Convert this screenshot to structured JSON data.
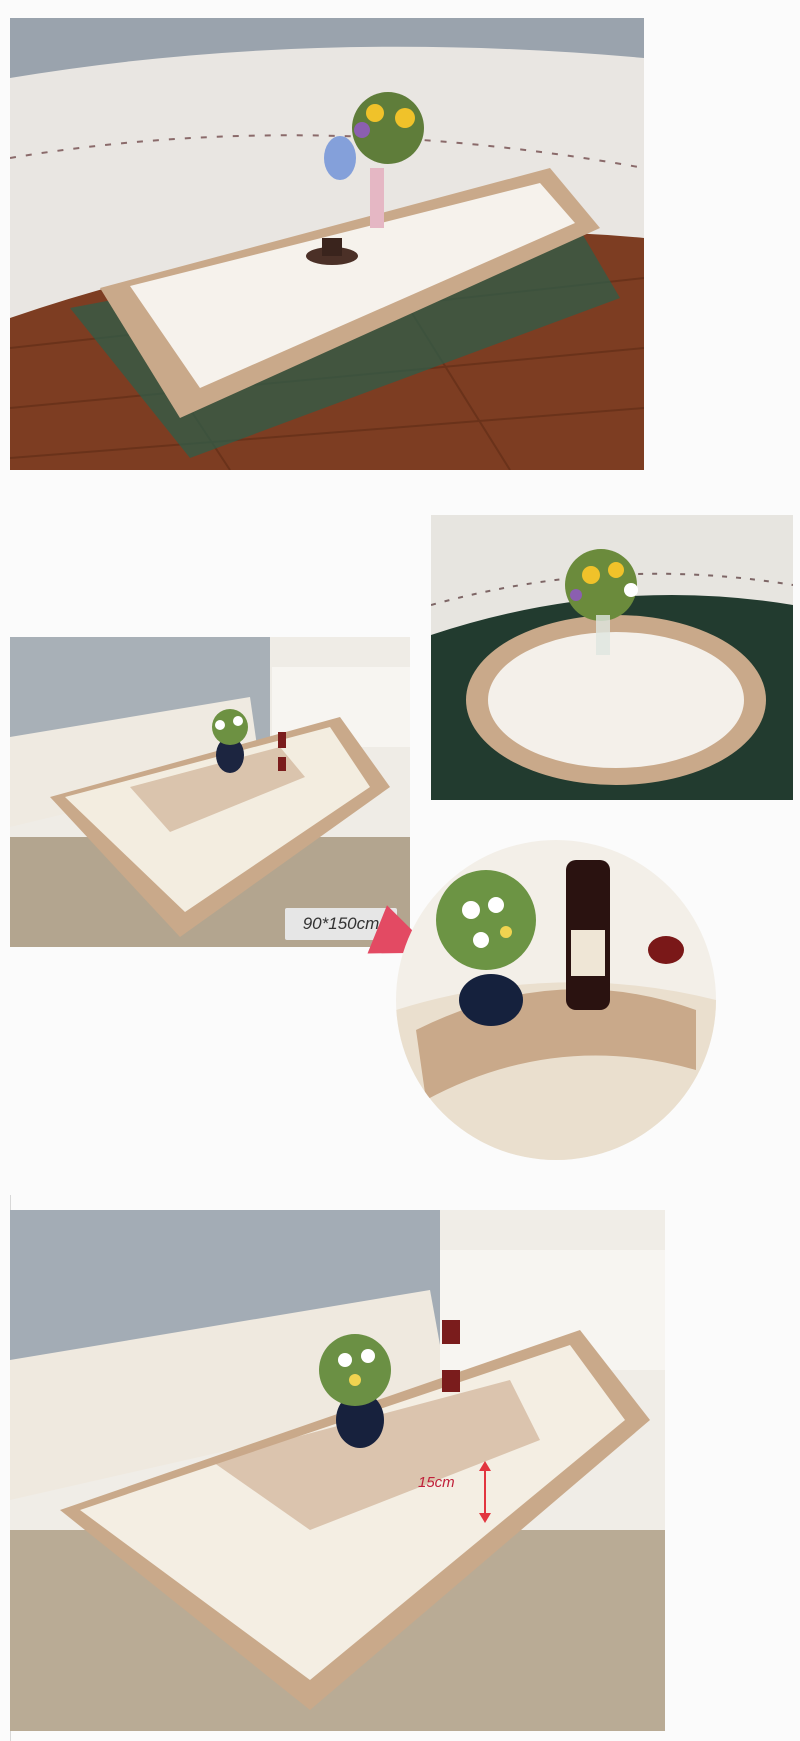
{
  "annotations": {
    "size_label": "90*150cm",
    "height_label": "15cm"
  },
  "colors": {
    "accent_pointer": "#e34a63",
    "height_text": "#c0203a",
    "lace": "#c9a98a",
    "floor_wood": "#7a3a1f",
    "sofa_grey": "#9aa3ad"
  }
}
